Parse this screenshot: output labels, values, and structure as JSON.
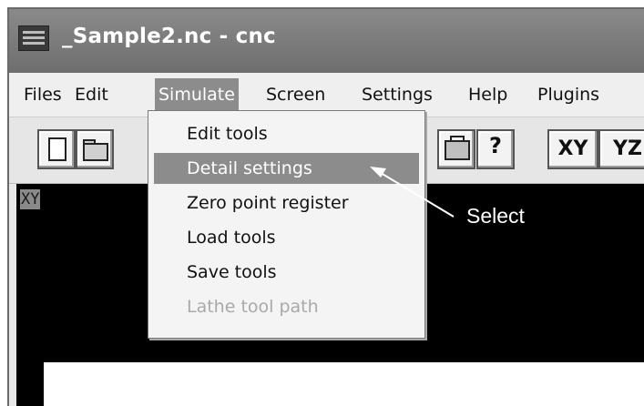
{
  "window": {
    "title": "_Sample2.nc - cnc"
  },
  "menubar": {
    "items": [
      {
        "label": "Files"
      },
      {
        "label": "Edit"
      },
      {
        "label": "Simulate",
        "active": true
      },
      {
        "label": "Screen"
      },
      {
        "label": "Settings"
      },
      {
        "label": "Help"
      },
      {
        "label": "Plugins"
      }
    ]
  },
  "toolbar": {
    "buttons": [
      {
        "name": "new-file",
        "icon": "document-icon"
      },
      {
        "name": "open-file",
        "icon": "folder-icon"
      },
      {
        "name": "print",
        "icon": "printer-icon"
      },
      {
        "name": "help",
        "icon": "help-icon",
        "glyph": "?"
      },
      {
        "name": "view-xy",
        "label": "XY"
      },
      {
        "name": "view-yz",
        "label": "YZ"
      }
    ]
  },
  "viewport": {
    "plane_label": "XY"
  },
  "simulate_menu": {
    "items": [
      {
        "label": "Edit tools",
        "state": "normal"
      },
      {
        "label": "Detail settings",
        "state": "highlighted"
      },
      {
        "label": "Zero point register",
        "state": "normal"
      },
      {
        "label": "Load tools",
        "state": "normal"
      },
      {
        "label": "Save tools",
        "state": "normal"
      },
      {
        "label": "Lathe tool path",
        "state": "disabled"
      }
    ]
  },
  "annotation": {
    "text": "Select"
  },
  "colors": {
    "titlebar": "#7a7a7a",
    "menu_highlight": "#8c8c8c",
    "viewport_bg": "#000000",
    "disabled_text": "#a9a9a9"
  }
}
